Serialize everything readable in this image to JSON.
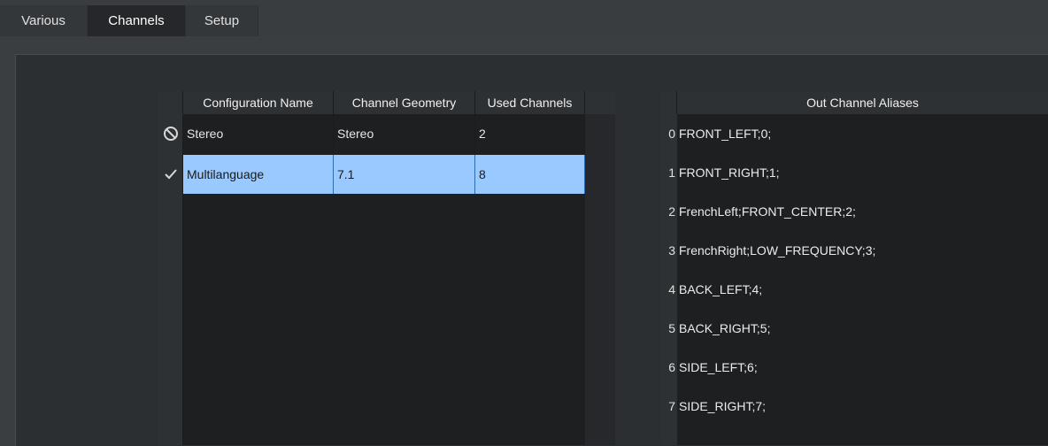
{
  "tabs": [
    {
      "label": "Various",
      "active": false
    },
    {
      "label": "Channels",
      "active": true
    },
    {
      "label": "Setup",
      "active": false
    }
  ],
  "configurations": {
    "columns": [
      "Configuration Name",
      "Channel Geometry",
      "Used Channels"
    ],
    "rows": [
      {
        "icon": "disabled-icon",
        "name": "Stereo",
        "geometry": "Stereo",
        "used": "2",
        "selected": false
      },
      {
        "icon": "checkmark-icon",
        "name": "Multilanguage",
        "geometry": "7.1",
        "used": "8",
        "selected": true
      }
    ]
  },
  "aliases": {
    "header": "Out Channel Aliases",
    "rows": [
      {
        "index": "0",
        "value": "FRONT_LEFT;0;"
      },
      {
        "index": "1",
        "value": "FRONT_RIGHT;1;"
      },
      {
        "index": "2",
        "value": "FrenchLeft;FRONT_CENTER;2;"
      },
      {
        "index": "3",
        "value": "FrenchRight;LOW_FREQUENCY;3;"
      },
      {
        "index": "4",
        "value": "BACK_LEFT;4;"
      },
      {
        "index": "5",
        "value": "BACK_RIGHT;5;"
      },
      {
        "index": "6",
        "value": "SIDE_LEFT;6;"
      },
      {
        "index": "7",
        "value": "SIDE_RIGHT;7;"
      }
    ]
  },
  "colors": {
    "selection": "#99c9ff",
    "background": "#1d1f21",
    "header": "#2e3134"
  }
}
